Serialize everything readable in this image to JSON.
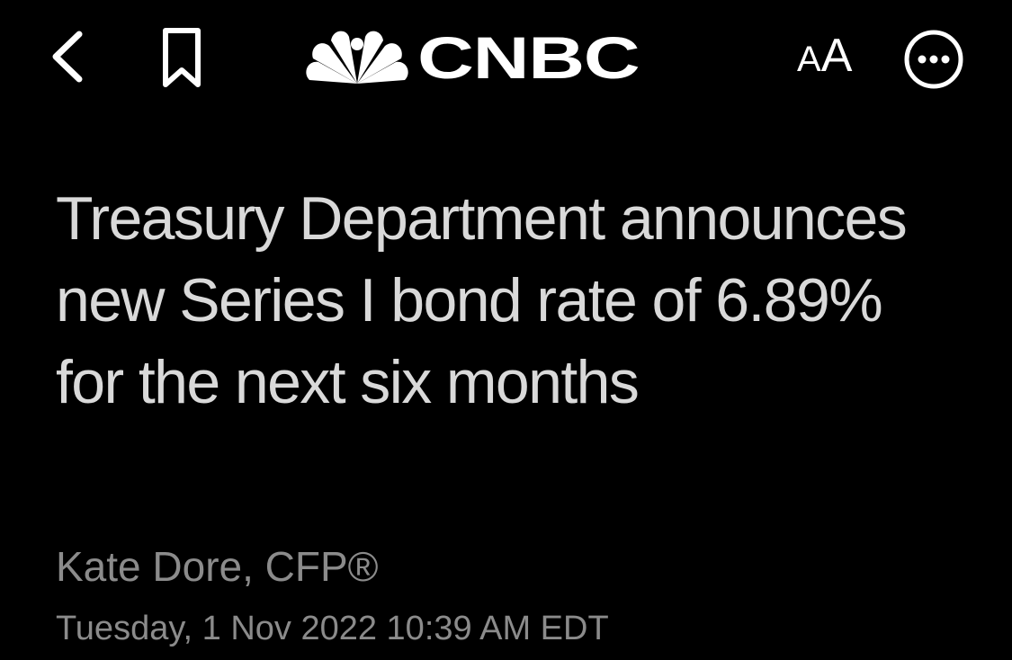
{
  "header": {
    "brand": "CNBC",
    "text_size_small": "A",
    "text_size_large": "A",
    "icons": {
      "back": "chevron-left-icon",
      "bookmark": "bookmark-icon",
      "logo": "nbc-peacock-icon",
      "text_size": "text-size-icon",
      "more": "more-ellipsis-icon"
    }
  },
  "article": {
    "headline": "Treasury Department announces new Series I bond rate of 6.89% for the next six months",
    "author": "Kate Dore, CFP®",
    "timestamp": "Tuesday, 1 Nov 2022 10:39 AM EDT"
  },
  "colors": {
    "background": "#000000",
    "headline": "#d9d9d9",
    "meta": "#8b8b8b",
    "icons": "#ffffff"
  }
}
